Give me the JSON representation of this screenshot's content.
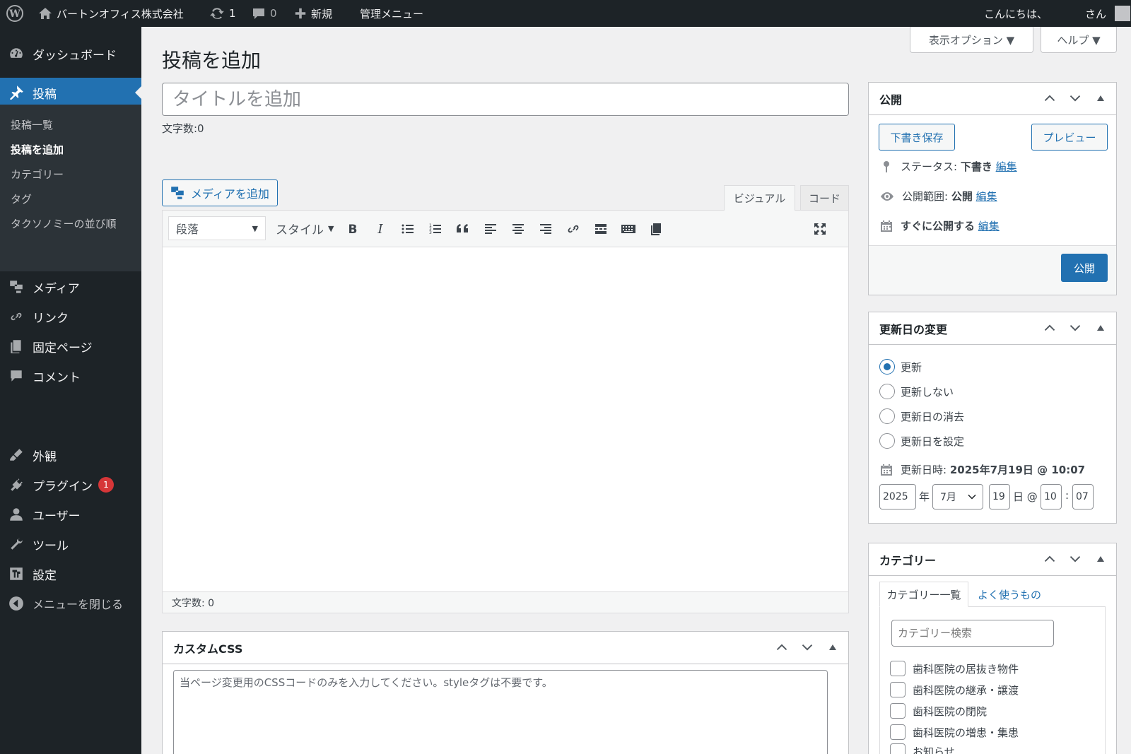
{
  "admin_bar": {
    "site_name": "バートンオフィス株式会社",
    "updates_count": "1",
    "comments_count": "0",
    "new_label": "新規",
    "admin_menu_label": "管理メニュー",
    "greeting": "こんにちは、",
    "greeting_suffix": "さん"
  },
  "sidebar": {
    "dashboard": "ダッシュボード",
    "posts": "投稿",
    "posts_sub": [
      "投稿一覧",
      "投稿を追加",
      "カテゴリー",
      "タグ",
      "タクソノミーの並び順"
    ],
    "media": "メディア",
    "links": "リンク",
    "pages": "固定ページ",
    "comments": "コメント",
    "appearance": "外観",
    "plugins": "プラグイン",
    "plugins_badge": "1",
    "users": "ユーザー",
    "tools": "ツール",
    "settings": "設定",
    "collapse": "メニューを閉じる"
  },
  "screen_options": {
    "display_label": "表示オプション ▼",
    "help_label": "ヘルプ ▼"
  },
  "page": {
    "title": "投稿を追加",
    "title_placeholder": "タイトルを追加",
    "char_count_top": "文字数:0"
  },
  "editor": {
    "add_media": "メディアを追加",
    "tab_visual": "ビジュアル",
    "tab_code": "コード",
    "format_select": "段落",
    "style_select": "スタイル",
    "char_count_bottom": "文字数: 0"
  },
  "publish_box": {
    "title": "公開",
    "save_draft": "下書き保存",
    "preview": "プレビュー",
    "status_label": "ステータス: ",
    "status_value": "下書き",
    "visibility_label": "公開範囲: ",
    "visibility_value": "公開",
    "schedule_label": "すぐに公開する",
    "edit_label": "編集",
    "publish_button": "公開"
  },
  "update_date_box": {
    "title": "更新日の変更",
    "options": [
      "更新",
      "更新しない",
      "更新日の消去",
      "更新日を設定"
    ],
    "selected_index": 0,
    "datetime_label": "更新日時: ",
    "datetime_value": "2025年7月19日 @ 10:07",
    "year": "2025",
    "year_suffix": "年",
    "month": "7月",
    "day": "19",
    "day_suffix": "日 @",
    "hour": "10",
    "time_sep": ":",
    "minute": "07"
  },
  "category_box": {
    "title": "カテゴリー",
    "tab_all": "カテゴリー一覧",
    "tab_popular": "よく使うもの",
    "search_placeholder": "カテゴリー検索",
    "items": [
      "歯科医院の居抜き物件",
      "歯科医院の継承・譲渡",
      "歯科医院の閉院",
      "歯科医院の増患・集患",
      "お知らせ"
    ]
  },
  "custom_css_box": {
    "title": "カスタムCSS",
    "placeholder": "当ページ変更用のCSSコードのみを入力してください。styleタグは不要です。"
  },
  "colors": {
    "admin_bar": "#1d2327",
    "sidebar": "#1d2327",
    "accent": "#2271b1",
    "badge": "#d63638"
  }
}
